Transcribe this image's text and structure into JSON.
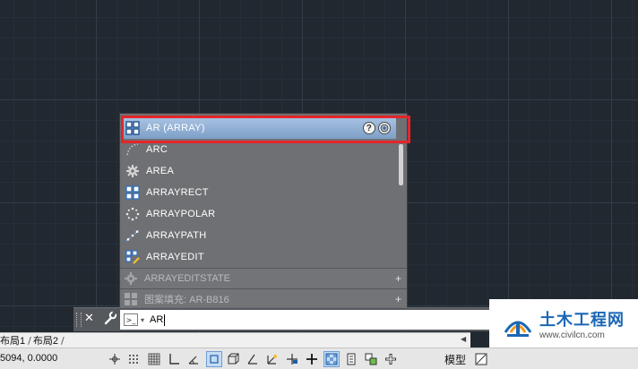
{
  "autocomplete": {
    "items": [
      {
        "label": "AR (ARRAY)",
        "icon": "array-icon",
        "selected": true
      },
      {
        "label": "ARC",
        "icon": "arc-icon"
      },
      {
        "label": "AREA",
        "icon": "area-gear-icon"
      },
      {
        "label": "ARRAYRECT",
        "icon": "array-rect-icon"
      },
      {
        "label": "ARRAYPOLAR",
        "icon": "array-polar-icon"
      },
      {
        "label": "ARRAYPATH",
        "icon": "array-path-icon"
      },
      {
        "label": "ARRAYEDIT",
        "icon": "array-edit-icon"
      }
    ],
    "sub_rows": [
      {
        "label": "ARRAYEDITSTATE",
        "expand": "+"
      },
      {
        "label": "图案填充: AR-B816",
        "expand": "+"
      }
    ],
    "help_glyph": "?"
  },
  "command_line": {
    "close_glyph": "✕",
    "prompt_glyph": ">_",
    "prompt_caret": "▾",
    "input_value": "AR"
  },
  "layout_tabs": {
    "tabs": [
      "布局1",
      "布局2"
    ],
    "separator": "/"
  },
  "status_bar": {
    "coordinates": "5094, 0.0000",
    "model_label": "模型"
  },
  "watermark": {
    "title": "土木工程网",
    "url": "www.civilcn.com"
  },
  "colors": {
    "canvas_bg": "#212830",
    "selection_highlight": "#e2262b",
    "selected_row": "#8fb0d6",
    "watermark_blue": "#1b67b4"
  }
}
